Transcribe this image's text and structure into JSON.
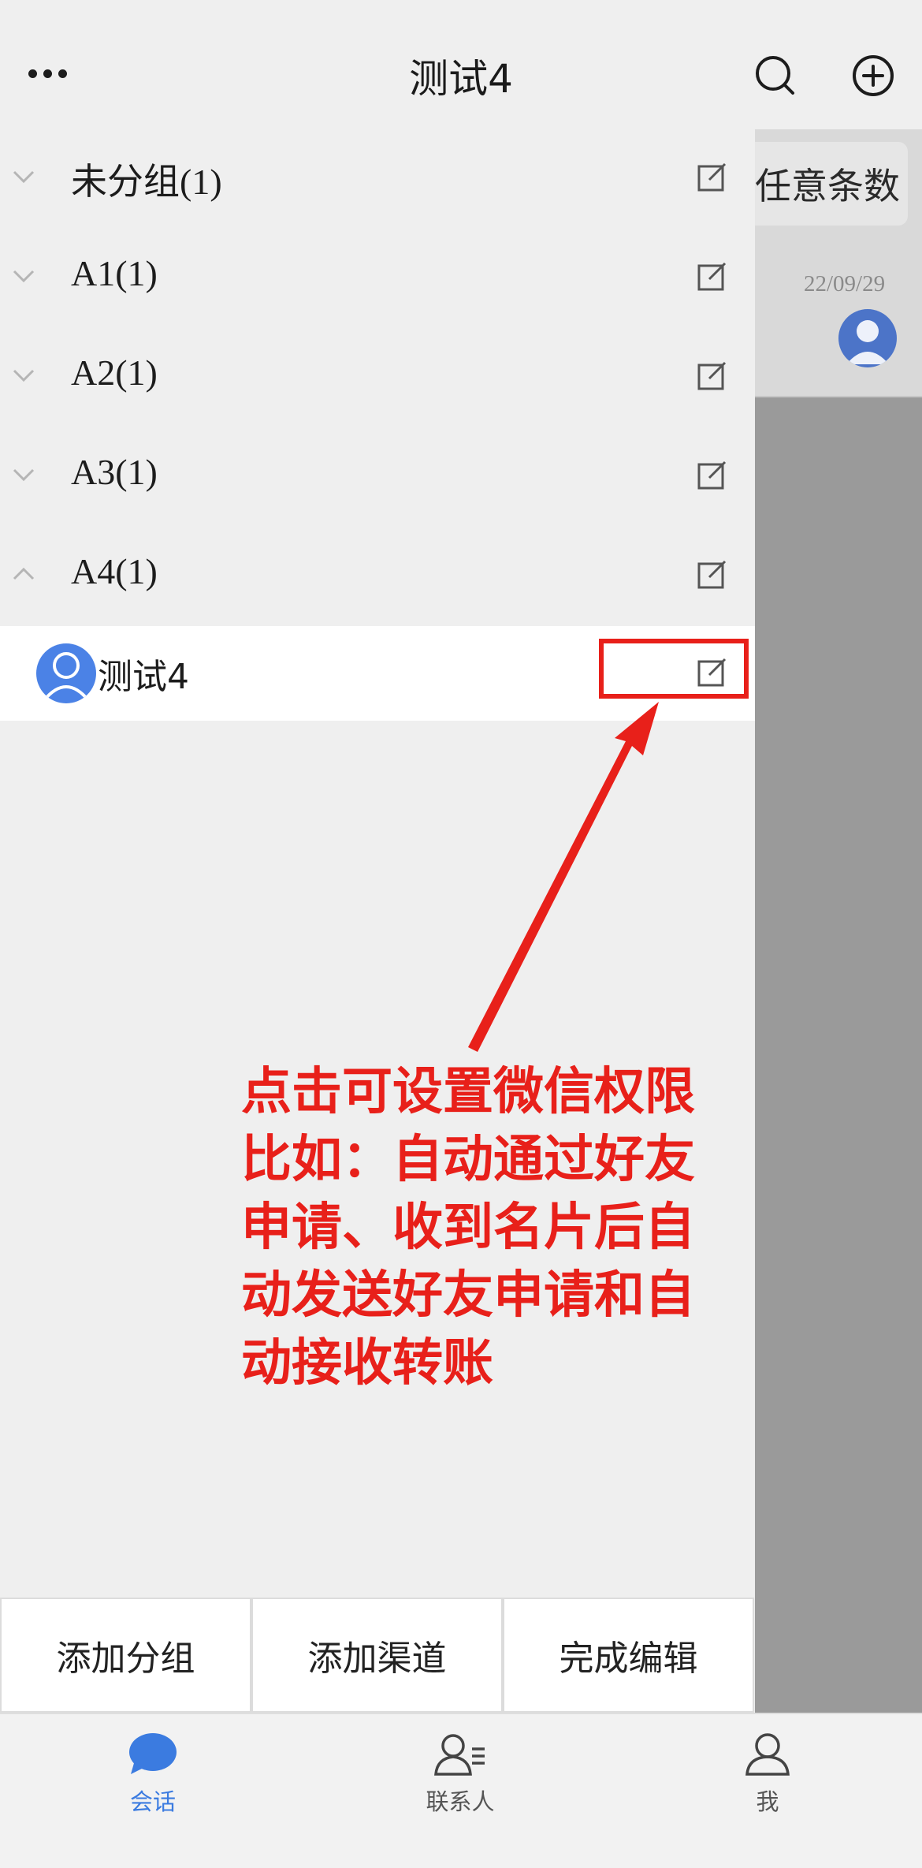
{
  "header": {
    "title": "测试4",
    "menu_icon": "more-dots-icon",
    "search_icon": "search-icon",
    "add_icon": "plus-circle-icon"
  },
  "background": {
    "chip_text": "任意条数",
    "date": "22/09/29"
  },
  "groups": [
    {
      "label": "未分组(1)",
      "expanded": false
    },
    {
      "label": "A1(1)",
      "expanded": false
    },
    {
      "label": "A2(1)",
      "expanded": false
    },
    {
      "label": "A3(1)",
      "expanded": false
    },
    {
      "label": "A4(1)",
      "expanded": true
    }
  ],
  "contact": {
    "name": "测试4"
  },
  "annotation": {
    "text": "点击可设置微信权限比如：自动通过好友申请、收到名片后自动发送好友申请和自动接收转账",
    "color": "#e8201a"
  },
  "actions": {
    "add_group": "添加分组",
    "add_channel": "添加渠道",
    "finish_edit": "完成编辑"
  },
  "tabs": [
    {
      "label": "会话",
      "icon": "chat-bubble-icon",
      "active": true
    },
    {
      "label": "联系人",
      "icon": "contacts-icon",
      "active": false
    },
    {
      "label": "我",
      "icon": "user-icon",
      "active": false
    }
  ],
  "colors": {
    "accent": "#3b7be0",
    "highlight": "#e8201a"
  }
}
